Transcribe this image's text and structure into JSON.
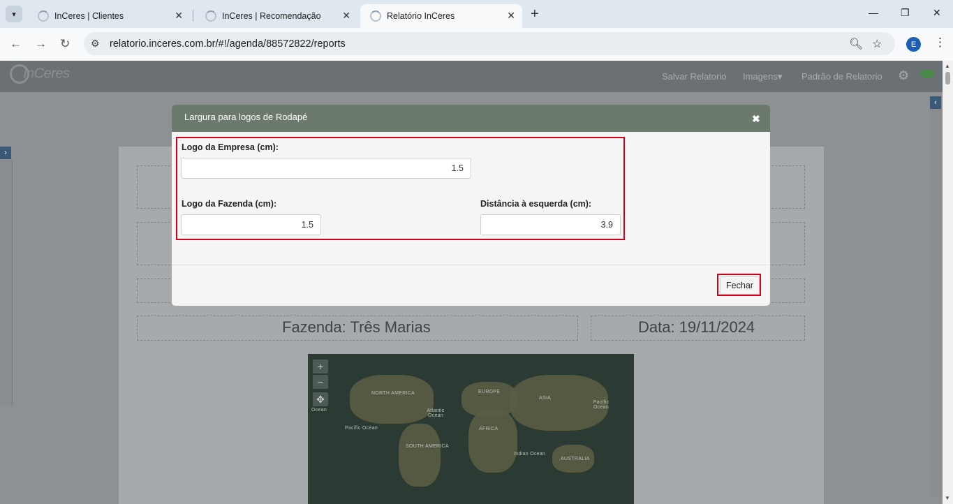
{
  "browser": {
    "tabs": [
      {
        "title": "InCeres | Clientes",
        "active": false
      },
      {
        "title": "InCeres | Recomendação",
        "active": false
      },
      {
        "title": "Relatório InCeres",
        "active": true
      }
    ],
    "url": "relatorio.inceres.com.br/#!/agenda/88572822/reports",
    "profile_initial": "E"
  },
  "app": {
    "logo": "InCeres",
    "nav": {
      "save": "Salvar Relatorio",
      "images": "Imagens",
      "pattern": "Padrão de Relatorio"
    },
    "report": {
      "farm": "Fazenda: Três Marias",
      "date": "Data: 19/11/2024"
    },
    "map_labels": {
      "north_america": "NORTH AMERICA",
      "europe": "EUROPE",
      "asia": "ASIA",
      "africa": "AFRICA",
      "south_america": "SOUTH AMERICA",
      "australia": "AUSTRALIA",
      "atlantic": "Atlantic Ocean",
      "pacific_l": "Pacific Ocean",
      "pacific_r": "Pacific Ocean",
      "indian": "Indian Ocean",
      "ocean_l": "Ocean"
    }
  },
  "modal": {
    "title": "Largura para logos de Rodapé",
    "fields": {
      "empresa": {
        "label": "Logo da Empresa (cm):",
        "value": "1.5"
      },
      "fazenda": {
        "label": "Logo da Fazenda (cm):",
        "value": "1.5"
      },
      "distancia": {
        "label": "Distância à esquerda (cm):",
        "value": "3.9"
      }
    },
    "close_button": "Fechar"
  },
  "colors": {
    "modal_header": "#6c7a6d",
    "highlight": "#d0021b",
    "profile": "#1a5fb4"
  }
}
